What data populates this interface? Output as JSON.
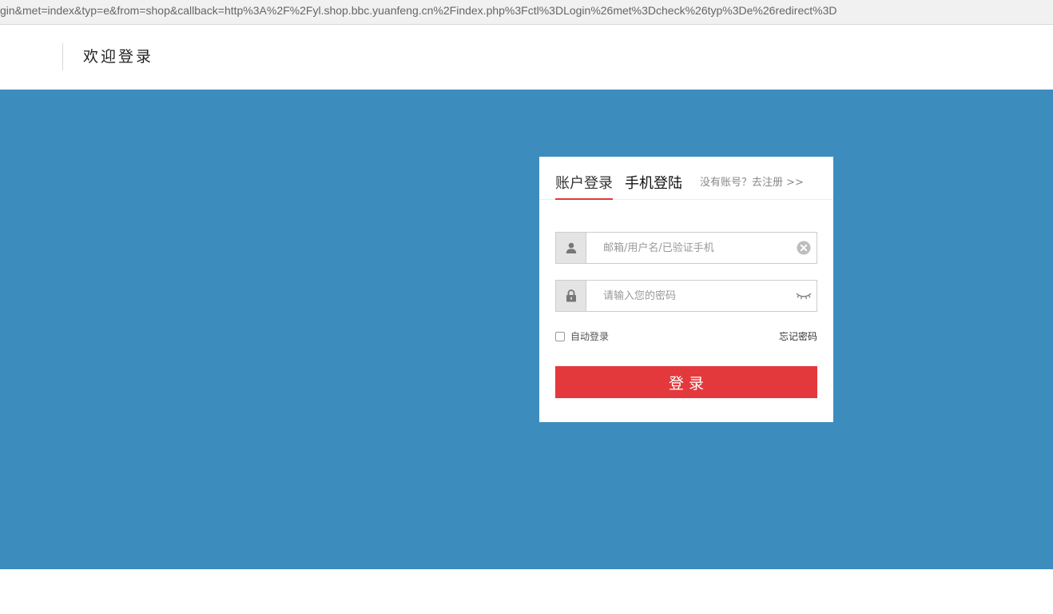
{
  "browser": {
    "url": "gin&met=index&typ=e&from=shop&callback=http%3A%2F%2Fyl.shop.bbc.yuanfeng.cn%2Findex.php%3Fctl%3DLogin%26met%3Dcheck%26typ%3De%26redirect%3D"
  },
  "header": {
    "title": "欢迎登录"
  },
  "colors": {
    "banner": "#3c8dbe",
    "accent": "#e4393c"
  },
  "login": {
    "tabs": [
      {
        "label": "账户登录",
        "active": true
      },
      {
        "label": "手机登陆",
        "active": false
      }
    ],
    "register_link": "没有账号？去注册 >>",
    "username": {
      "value": "",
      "placeholder": "邮箱/用户名/已验证手机",
      "lead_icon": "user-icon",
      "trail_icon": "clear-icon"
    },
    "password": {
      "value": "",
      "placeholder": "请输入您的密码",
      "lead_icon": "lock-icon",
      "trail_icon": "eye-closed-icon"
    },
    "auto_login_label": "自动登录",
    "auto_login_checked": false,
    "forgot_label": "忘记密码",
    "submit_label": "登录"
  }
}
